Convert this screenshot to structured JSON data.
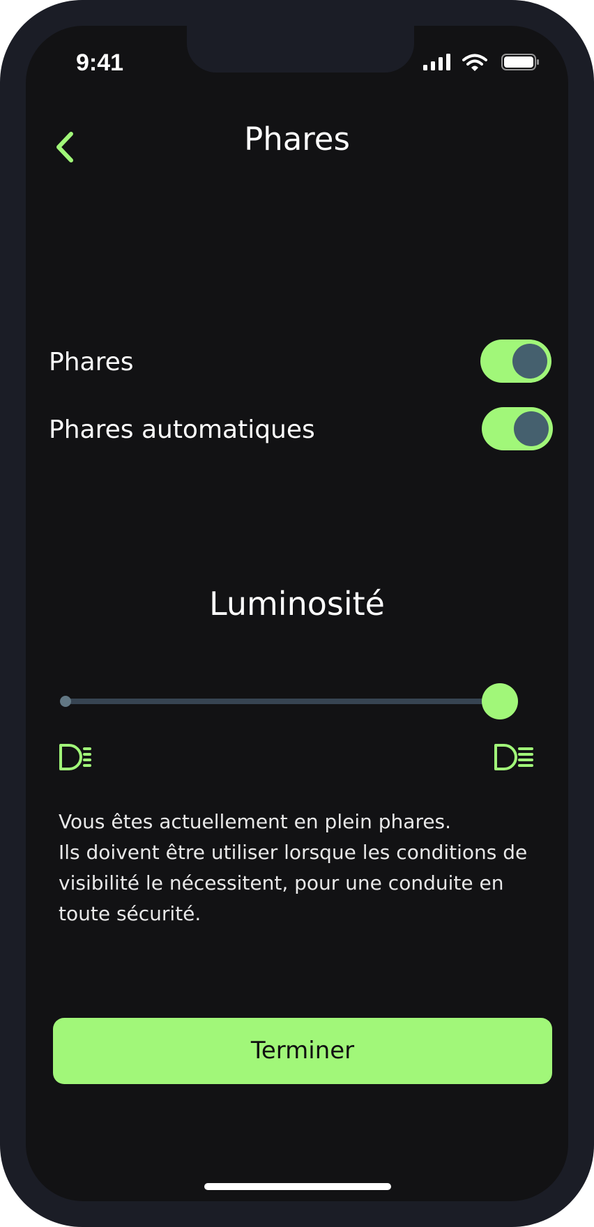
{
  "status_bar": {
    "time": "9:41",
    "icons": [
      "cellular-signal-icon",
      "wifi-icon",
      "battery-icon"
    ]
  },
  "header": {
    "back_icon": "chevron-left-icon",
    "title": "Phares"
  },
  "settings": [
    {
      "label": "Phares",
      "enabled": true
    },
    {
      "label": "Phares automatiques",
      "enabled": true
    }
  ],
  "brightness": {
    "title": "Luminosité",
    "value_fraction": 1.0,
    "min_icon": "low-beam-headlight-icon",
    "max_icon": "high-beam-headlight-icon"
  },
  "description": {
    "line1": "Vous êtes actuellement en plein phares.",
    "line2": "Ils doivent être utiliser lorsque les conditions de visibilité le nécessitent, pour une conduite en toute sécurité."
  },
  "action": {
    "button_label": "Terminer"
  },
  "colors": {
    "accent": "#a1f779",
    "background": "#121214",
    "knob": "#45606e",
    "track": "#374452"
  }
}
